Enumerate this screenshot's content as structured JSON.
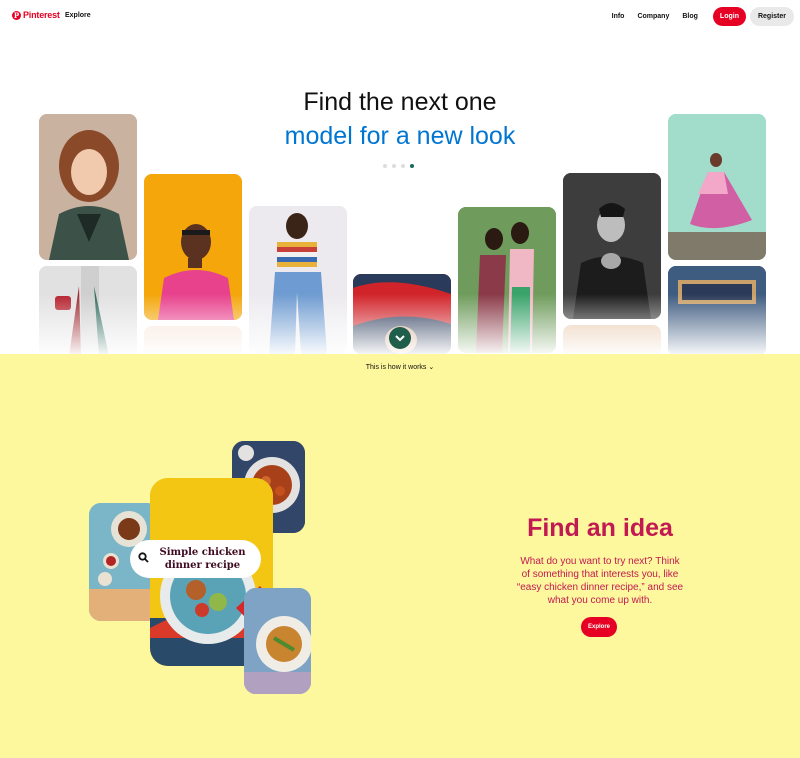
{
  "header": {
    "logo_text": "Pinterest",
    "explore": "Explore",
    "links": [
      "Info",
      "Company",
      "Blog"
    ],
    "login": "Login",
    "register": "Register"
  },
  "hero": {
    "title": "Find the next one",
    "subtitle": "model for a new look",
    "dots_count": 4,
    "active_dot": 4
  },
  "how_it_works": {
    "label": "This is how it works",
    "chevron": "⌄"
  },
  "idea": {
    "search_text": "Simple chicken dinner recipe",
    "title": "Find an idea",
    "description": "What do you want to try next? Think of something that interests you, like “easy chicken dinner recipe,” and see what you come up with.",
    "button": "Explore"
  },
  "colors": {
    "brand_red": "#e60023",
    "hero_blue": "#0076d3",
    "strip_yellow": "#fdf79d",
    "idea_text": "#c31952",
    "teal": "#1f5e4a"
  }
}
